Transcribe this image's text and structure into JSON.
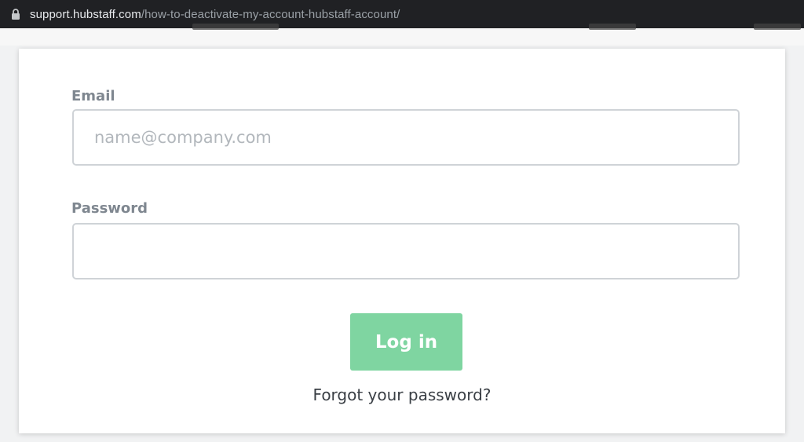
{
  "browser": {
    "url_domain": "support.hubstaff.com",
    "url_path": "/how-to-deactivate-my-account-hubstaff-account/",
    "lock_icon": "lock-icon"
  },
  "login_form": {
    "email_label": "Email",
    "email_placeholder": "name@company.com",
    "email_value": "",
    "password_label": "Password",
    "password_value": "",
    "login_button_label": "Log in",
    "login_button_color": "#7fd5a1",
    "forgot_link": "Forgot your password?"
  }
}
